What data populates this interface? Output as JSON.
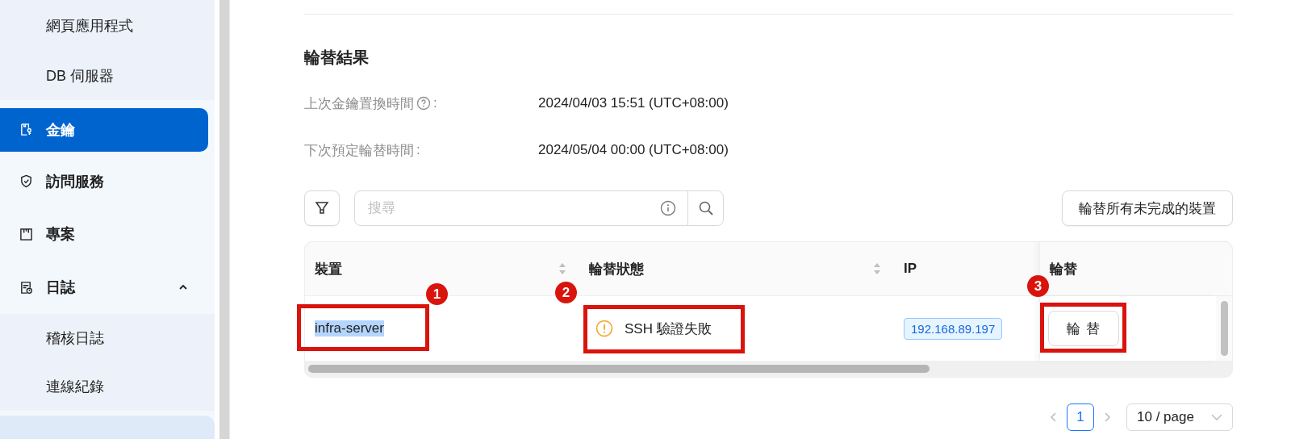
{
  "sidebar": {
    "items": [
      {
        "label": "網頁應用程式",
        "sub": true,
        "selected": false
      },
      {
        "label": "DB 伺服器",
        "sub": true,
        "selected": false
      },
      {
        "label": "金鑰",
        "sub": false,
        "selected": true
      },
      {
        "label": "訪問服務",
        "sub": false,
        "selected": false
      },
      {
        "label": "專案",
        "sub": false,
        "selected": false
      },
      {
        "label": "日誌",
        "sub": false,
        "selected": false,
        "expanded": true
      },
      {
        "label": "稽核日誌",
        "sub": true,
        "selected": false
      },
      {
        "label": "連線紀錄",
        "sub": true,
        "selected": false
      }
    ]
  },
  "section": {
    "title": "輪替結果",
    "fields": [
      {
        "label": "上次金鑰置換時間",
        "help": true,
        "colon": ":",
        "value": "2024/04/03 15:51 (UTC+08:00)"
      },
      {
        "label": "下次預定輪替時間",
        "colon": ":",
        "value": "2024/05/04 00:00 (UTC+08:00)"
      }
    ]
  },
  "toolbar": {
    "search_placeholder": "搜尋",
    "rotate_all_button": "輪替所有未完成的裝置"
  },
  "table": {
    "columns": [
      {
        "label": "裝置",
        "sortable": true
      },
      {
        "label": "輪替狀態",
        "sortable": true
      },
      {
        "label": "IP",
        "sortable": false
      },
      {
        "label": "輪替",
        "sortable": false
      }
    ],
    "rows": [
      {
        "device": "infra-server",
        "device_highlighted": true,
        "status": "SSH 驗證失敗",
        "ip": "192.168.89.197",
        "action": "輪 替"
      }
    ]
  },
  "annotations": [
    {
      "number": "1"
    },
    {
      "number": "2"
    },
    {
      "number": "3"
    }
  ],
  "pagination": {
    "pages": [
      {
        "label": "1",
        "selected": true
      }
    ],
    "page_size": "10 / page"
  }
}
